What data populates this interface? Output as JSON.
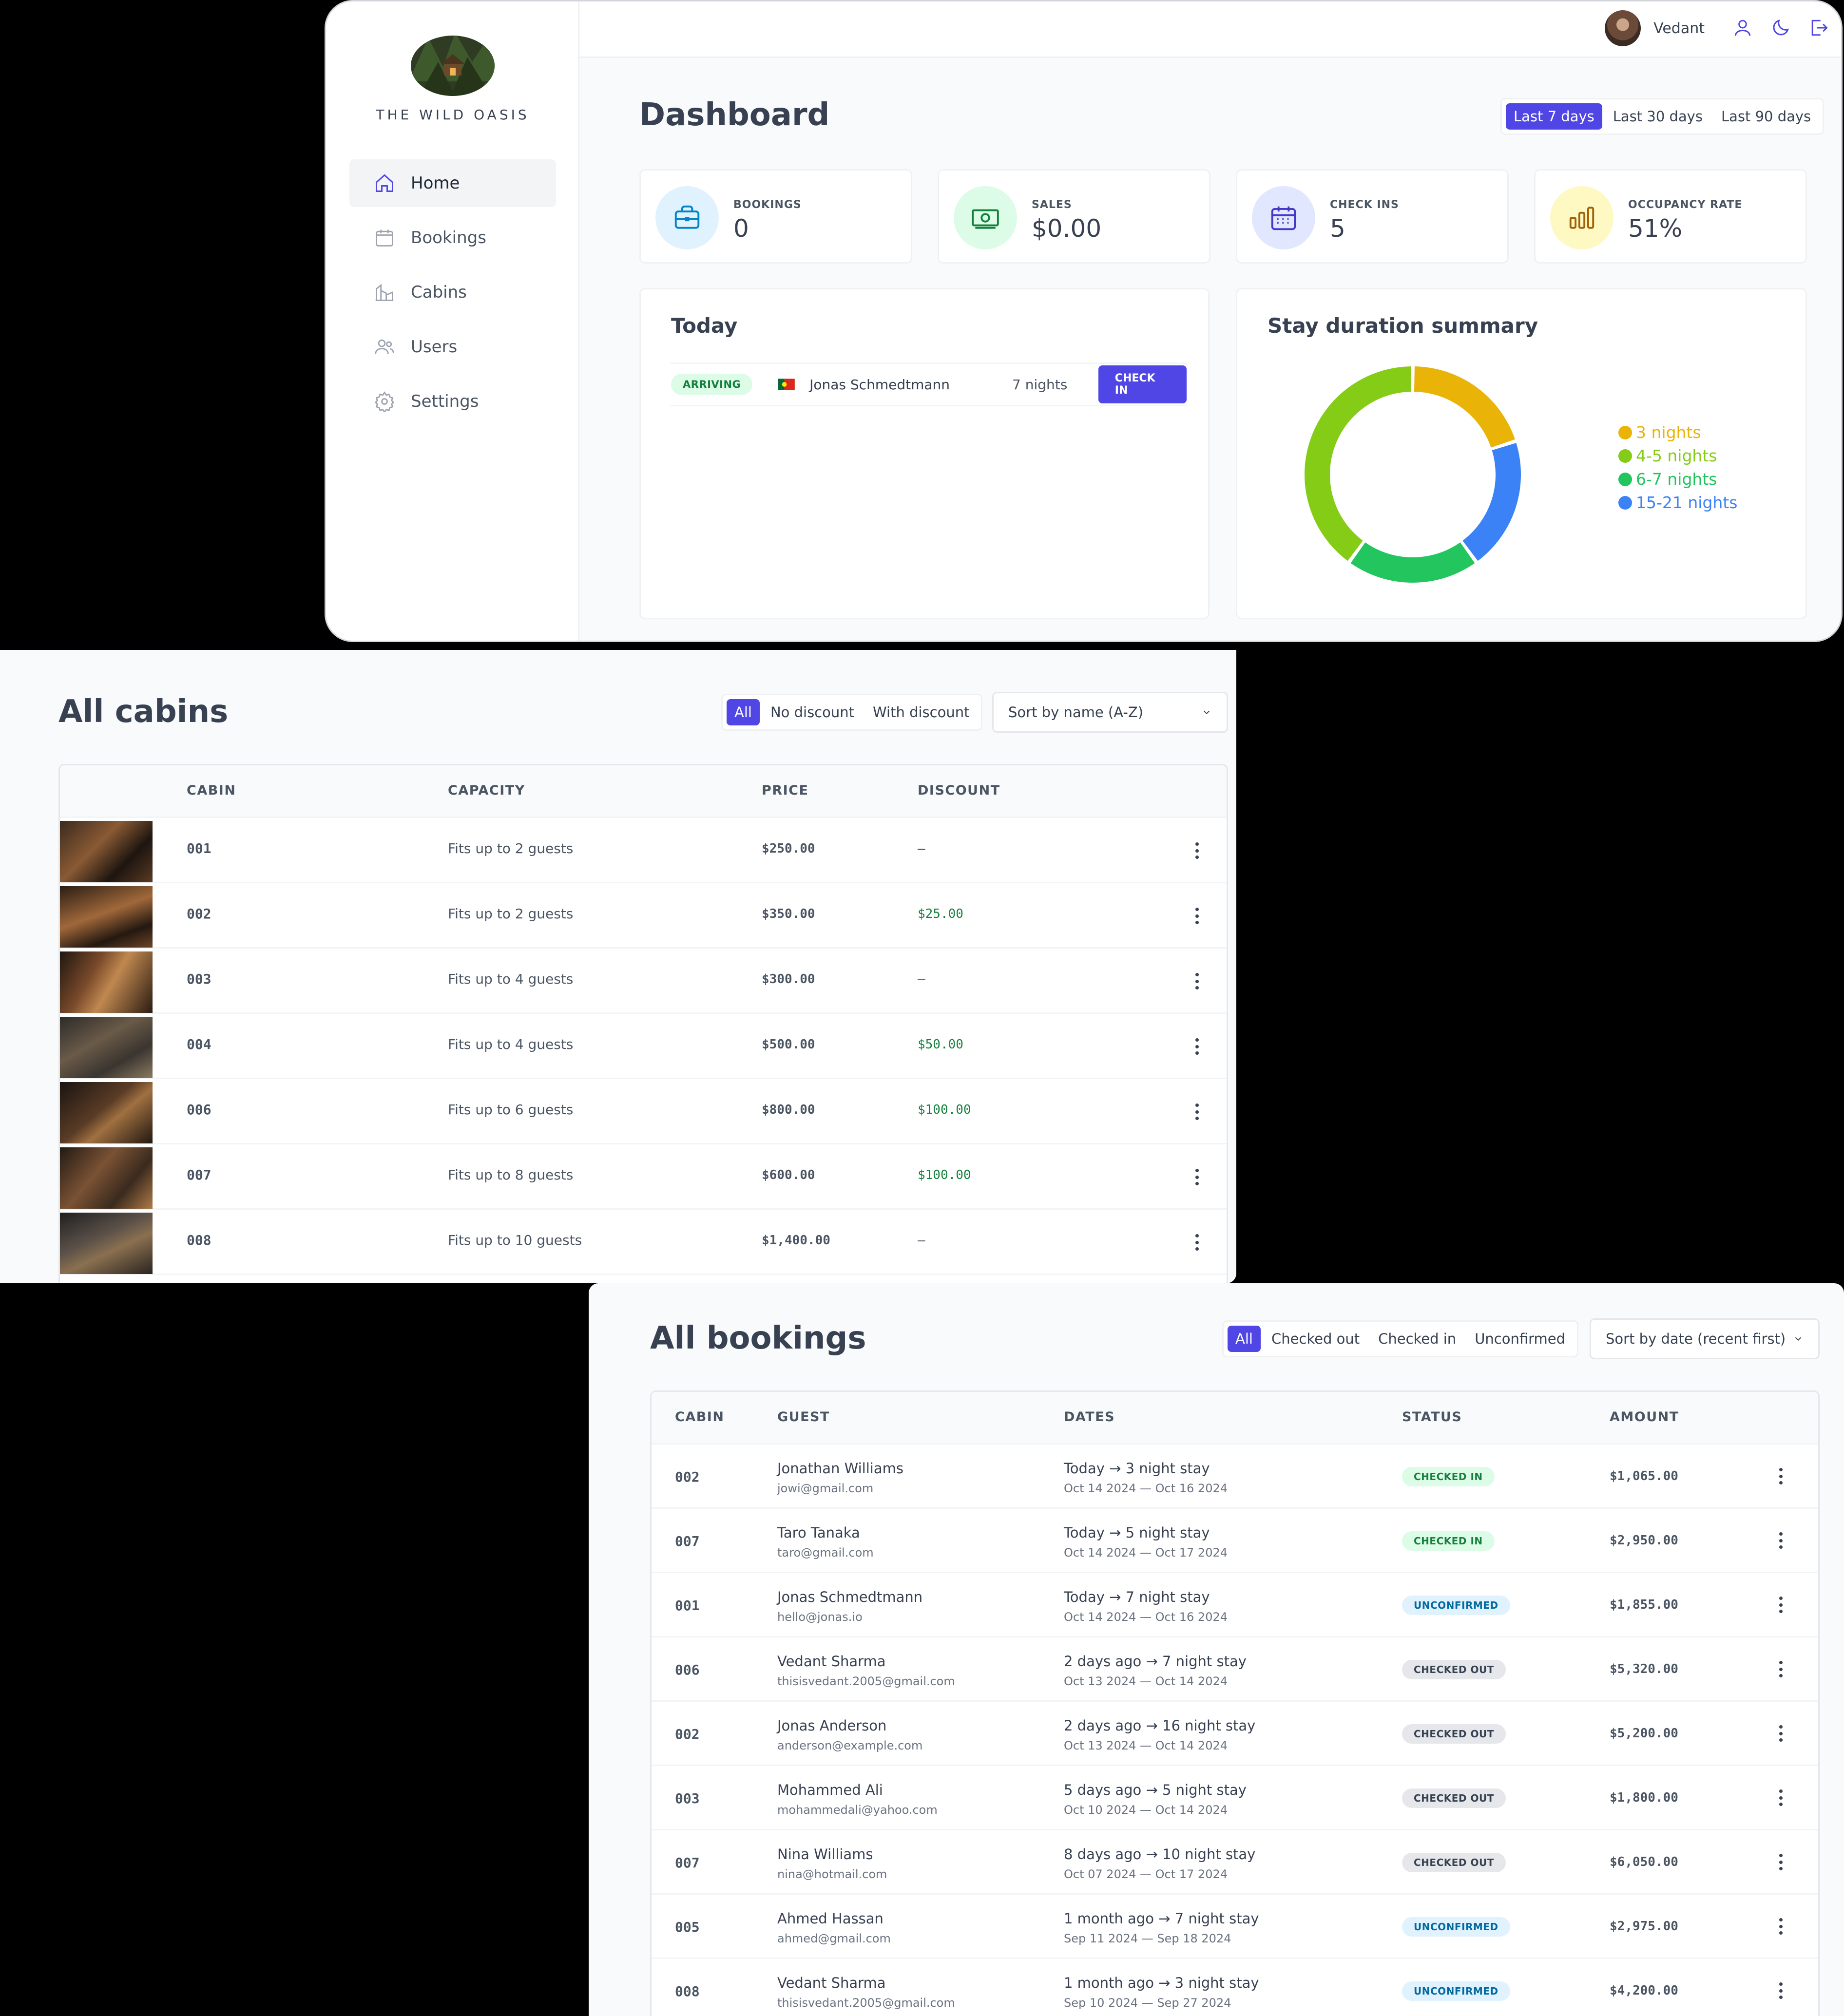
{
  "dashboard": {
    "brand": "THE WILD OASIS",
    "nav": [
      {
        "label": "Home",
        "icon": "home-icon",
        "active": true
      },
      {
        "label": "Bookings",
        "icon": "calendar-icon",
        "active": false
      },
      {
        "label": "Cabins",
        "icon": "cabin-icon",
        "active": false
      },
      {
        "label": "Users",
        "icon": "users-icon",
        "active": false
      },
      {
        "label": "Settings",
        "icon": "gear-icon",
        "active": false
      }
    ],
    "user_name": "Vedant",
    "title": "Dashboard",
    "filters": [
      "Last 7 days",
      "Last 30 days",
      "Last 90 days"
    ],
    "active_filter": 0,
    "stats": [
      {
        "label": "BOOKINGS",
        "value": "0",
        "icon": "briefcase-icon",
        "color": "#0284c7",
        "bg": "#e0f2fe"
      },
      {
        "label": "SALES",
        "value": "$0.00",
        "icon": "banknotes-icon",
        "color": "#15803d",
        "bg": "#dcfce7"
      },
      {
        "label": "CHECK INS",
        "value": "5",
        "icon": "calendar-days-icon",
        "color": "#4338ca",
        "bg": "#e0e7ff"
      },
      {
        "label": "OCCUPANCY RATE",
        "value": "51%",
        "icon": "chart-bar-icon",
        "color": "#a16207",
        "bg": "#fef9c3"
      }
    ],
    "today": {
      "title": "Today",
      "status": "ARRIVING",
      "guest": "Jonas Schmedtmann",
      "nights": "7 nights",
      "action": "CHECK IN"
    },
    "stay_summary": {
      "title": "Stay duration summary",
      "chart_data": {
        "type": "pie",
        "categories": [
          "3 nights",
          "4-5 nights",
          "6-7 nights",
          "15-21 nights"
        ],
        "values": [
          1,
          2,
          1,
          1
        ],
        "colors": [
          "#eab308",
          "#84cc16",
          "#22c55e",
          "#3b82f6"
        ]
      }
    }
  },
  "cabins": {
    "title": "All cabins",
    "filters": [
      "All",
      "No discount",
      "With discount"
    ],
    "active_filter": 0,
    "sort": "Sort by name (A-Z)",
    "columns": [
      "CABIN",
      "CAPACITY",
      "PRICE",
      "DISCOUNT"
    ],
    "rows": [
      {
        "name": "001",
        "capacity": "Fits up to 2 guests",
        "price": "$250.00",
        "discount": "—"
      },
      {
        "name": "002",
        "capacity": "Fits up to 2 guests",
        "price": "$350.00",
        "discount": "$25.00"
      },
      {
        "name": "003",
        "capacity": "Fits up to 4 guests",
        "price": "$300.00",
        "discount": "—"
      },
      {
        "name": "004",
        "capacity": "Fits up to 4 guests",
        "price": "$500.00",
        "discount": "$50.00"
      },
      {
        "name": "006",
        "capacity": "Fits up to 6 guests",
        "price": "$800.00",
        "discount": "$100.00"
      },
      {
        "name": "007",
        "capacity": "Fits up to 8 guests",
        "price": "$600.00",
        "discount": "$100.00"
      },
      {
        "name": "008",
        "capacity": "Fits up to 10 guests",
        "price": "$1,400.00",
        "discount": "—"
      }
    ]
  },
  "bookings": {
    "title": "All bookings",
    "filters": [
      "All",
      "Checked out",
      "Checked in",
      "Unconfirmed"
    ],
    "active_filter": 0,
    "sort": "Sort by date (recent first)",
    "columns": [
      "CABIN",
      "GUEST",
      "DATES",
      "STATUS",
      "AMOUNT"
    ],
    "rows": [
      {
        "cabin": "002",
        "guest": "Jonathan Williams",
        "email": "jowi@gmail.com",
        "when": "Today → 3 night stay",
        "dates": "Oct 14 2024 — Oct 16 2024",
        "status": "CHECKED IN",
        "amount": "$1,065.00"
      },
      {
        "cabin": "007",
        "guest": "Taro Tanaka",
        "email": "taro@gmail.com",
        "when": "Today → 5 night stay",
        "dates": "Oct 14 2024 — Oct 17 2024",
        "status": "CHECKED IN",
        "amount": "$2,950.00"
      },
      {
        "cabin": "001",
        "guest": "Jonas Schmedtmann",
        "email": "hello@jonas.io",
        "when": "Today → 7 night stay",
        "dates": "Oct 14 2024 — Oct 16 2024",
        "status": "UNCONFIRMED",
        "amount": "$1,855.00"
      },
      {
        "cabin": "006",
        "guest": "Vedant Sharma",
        "email": "thisisvedant.2005@gmail.com",
        "when": "2 days ago → 7 night stay",
        "dates": "Oct 13 2024 — Oct 14 2024",
        "status": "CHECKED OUT",
        "amount": "$5,320.00"
      },
      {
        "cabin": "002",
        "guest": "Jonas Anderson",
        "email": "anderson@example.com",
        "when": "2 days ago → 16 night stay",
        "dates": "Oct 13 2024 — Oct 14 2024",
        "status": "CHECKED OUT",
        "amount": "$5,200.00"
      },
      {
        "cabin": "003",
        "guest": "Mohammed Ali",
        "email": "mohammedali@yahoo.com",
        "when": "5 days ago → 5 night stay",
        "dates": "Oct 10 2024 — Oct 14 2024",
        "status": "CHECKED OUT",
        "amount": "$1,800.00"
      },
      {
        "cabin": "007",
        "guest": "Nina Williams",
        "email": "nina@hotmail.com",
        "when": "8 days ago → 10 night stay",
        "dates": "Oct 07 2024 — Oct 17 2024",
        "status": "CHECKED OUT",
        "amount": "$6,050.00"
      },
      {
        "cabin": "005",
        "guest": "Ahmed Hassan",
        "email": "ahmed@gmail.com",
        "when": "1 month ago → 7 night stay",
        "dates": "Sep 11 2024 — Sep 18 2024",
        "status": "UNCONFIRMED",
        "amount": "$2,975.00"
      },
      {
        "cabin": "008",
        "guest": "Vedant Sharma",
        "email": "thisisvedant.2005@gmail.com",
        "when": "1 month ago → 3 night stay",
        "dates": "Sep 10 2024 — Sep 27 2024",
        "status": "UNCONFIRMED",
        "amount": "$4,200.00"
      }
    ]
  }
}
